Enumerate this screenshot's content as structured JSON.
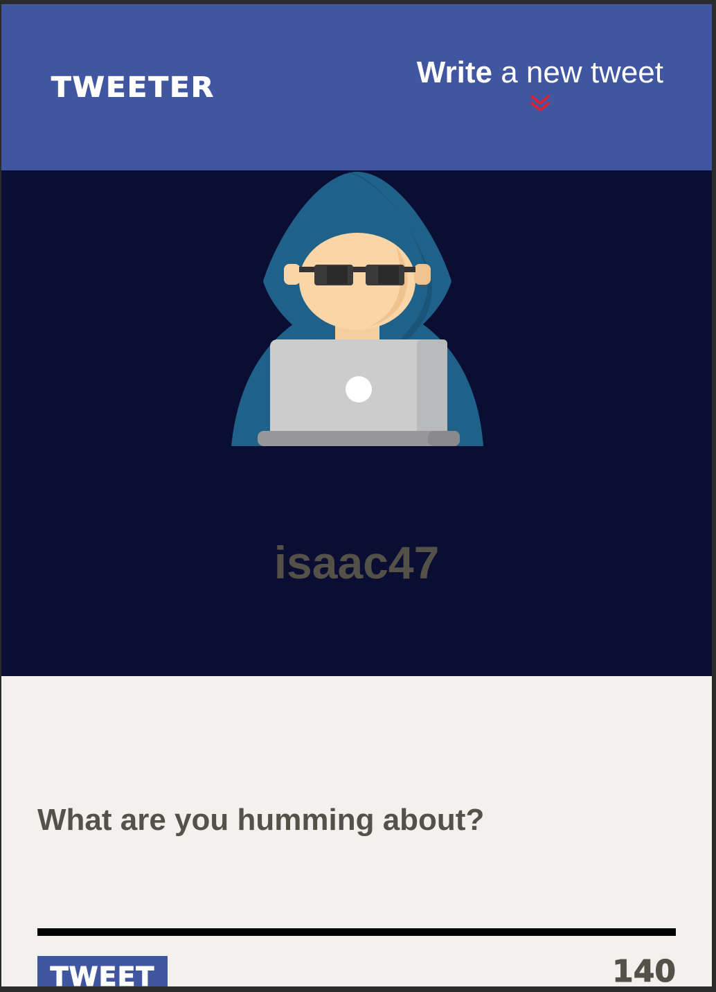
{
  "header": {
    "brand": "TWEETER",
    "compose_toggle_strong": "Write",
    "compose_toggle_rest": "a new tweet",
    "toggle_icon": "chevron-double-down-icon",
    "toggle_icon_color": "#e0202a"
  },
  "profile": {
    "avatar_icon": "hacker-avatar-icon",
    "username": "isaac47"
  },
  "compose": {
    "placeholder": "What are you humming about?",
    "value": "",
    "submit_label": "TWEET",
    "char_counter": "140"
  },
  "colors": {
    "nav_background": "#4056a1",
    "profile_background": "#0b0e33",
    "page_background": "#f2f1ed",
    "text_muted": "#545149",
    "button_background": "#4056a1"
  }
}
